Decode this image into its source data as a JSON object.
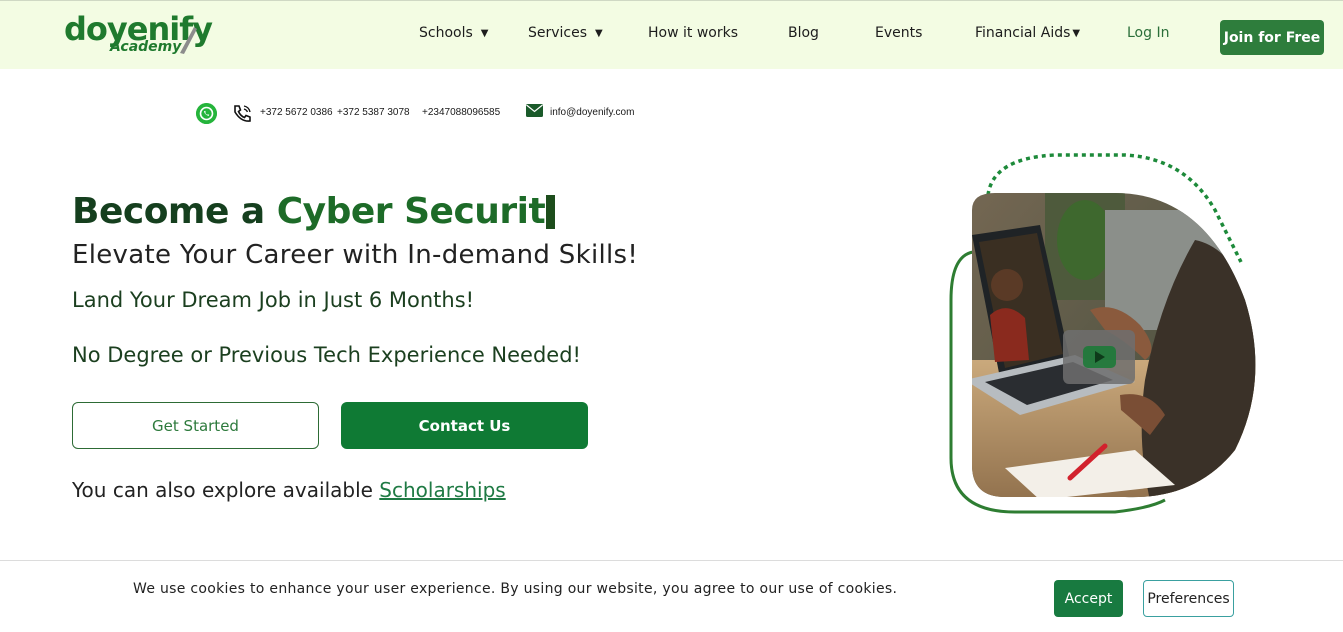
{
  "brand": {
    "name": "doyenify",
    "sub": "Academy"
  },
  "nav": {
    "schools": "Schools",
    "services": "Services",
    "how_it_works": "How it works",
    "blog": "Blog",
    "events": "Events",
    "financial_aids": "Financial Aids",
    "login": "Log In",
    "join": "Join for Free"
  },
  "contact": {
    "phones": [
      "+372 5672 0386",
      "+372 5387 3078",
      "+2347088096585"
    ],
    "email": "info@doyenify.com",
    "icons": [
      "whatsapp-icon",
      "phone-icon",
      "mail-icon"
    ]
  },
  "hero": {
    "title_prefix": "Become a",
    "title_typed": "Cyber Securit",
    "subtitle": "Elevate Your Career with In-demand Skills!",
    "line2": "Land Your Dream Job in Just 6 Months!",
    "line3": "No Degree or Previous Tech Experience Needed!",
    "get_started": "Get Started",
    "contact_us": "Contact Us",
    "explore_prefix": "You can also explore available",
    "explore_link": "Scholarships"
  },
  "cookie": {
    "text": "We use cookies to enhance your user experience. By using our website, you agree to our use of cookies.",
    "accept": "Accept",
    "preferences": "Preferences"
  },
  "colors": {
    "brand_green": "#1f7a2e",
    "button_green": "#0f7a34",
    "topbar_bg": "#f3fce3"
  }
}
